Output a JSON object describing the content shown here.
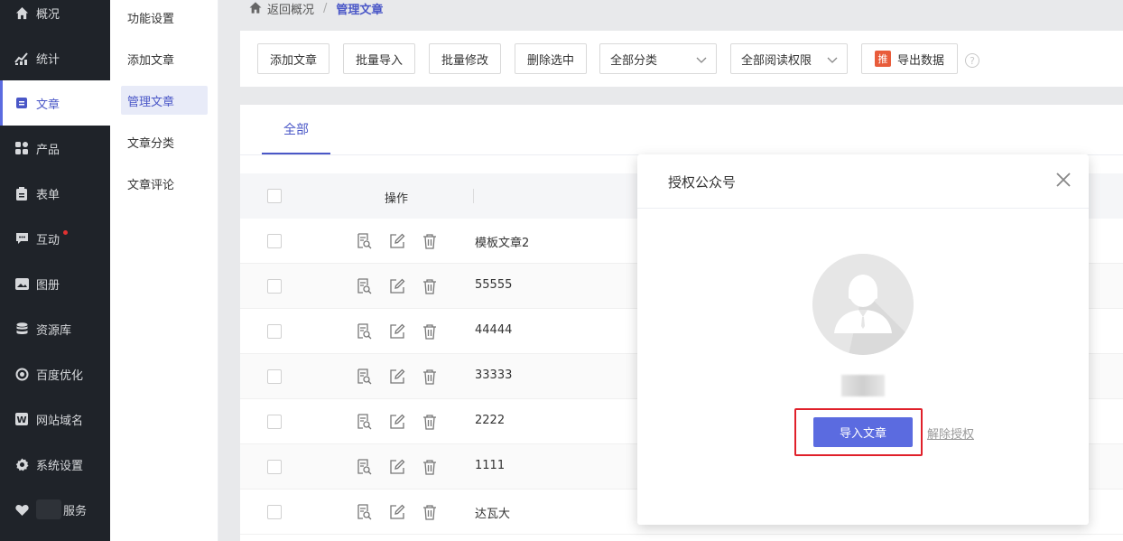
{
  "sidebar": {
    "items": [
      {
        "label": "概况",
        "icon": "home-icon"
      },
      {
        "label": "统计",
        "icon": "chart-icon"
      },
      {
        "label": "文章",
        "icon": "article-icon",
        "active": true
      },
      {
        "label": "产品",
        "icon": "grid-icon"
      },
      {
        "label": "表单",
        "icon": "form-icon"
      },
      {
        "label": "互动",
        "icon": "chat-icon",
        "badge": true
      },
      {
        "label": "图册",
        "icon": "gallery-icon"
      },
      {
        "label": "资源库",
        "icon": "database-icon"
      },
      {
        "label": "百度优化",
        "icon": "seo-icon"
      },
      {
        "label": "网站域名",
        "icon": "domain-icon"
      },
      {
        "label": "系统设置",
        "icon": "gear-icon"
      },
      {
        "label": "服务",
        "icon": "heart-icon"
      }
    ]
  },
  "submenu": {
    "items": [
      "功能设置",
      "添加文章",
      "管理文章",
      "文章分类",
      "文章评论"
    ],
    "active": "管理文章"
  },
  "breadcrumb": {
    "back": "返回概况",
    "separator": "/",
    "current": "管理文章"
  },
  "toolbar": {
    "add": "添加文章",
    "import": "批量导入",
    "batch_edit": "批量修改",
    "delete_selected": "删除选中",
    "category_select": "全部分类",
    "permission_select": "全部阅读权限",
    "export": "导出数据",
    "export_badge": "推",
    "help": "?"
  },
  "tabs": {
    "all": "全部"
  },
  "table": {
    "op_header": "操作",
    "rows": [
      "模板文章2",
      "55555",
      "44444",
      "33333",
      "2222",
      "1111",
      "达瓦大"
    ]
  },
  "modal": {
    "title": "授权公众号",
    "import_button": "导入文章",
    "revoke_link": "解除授权"
  },
  "colors": {
    "accent": "#5b6be0",
    "sidebar_bg": "#1f2329",
    "highlight_border": "#e0202a"
  }
}
